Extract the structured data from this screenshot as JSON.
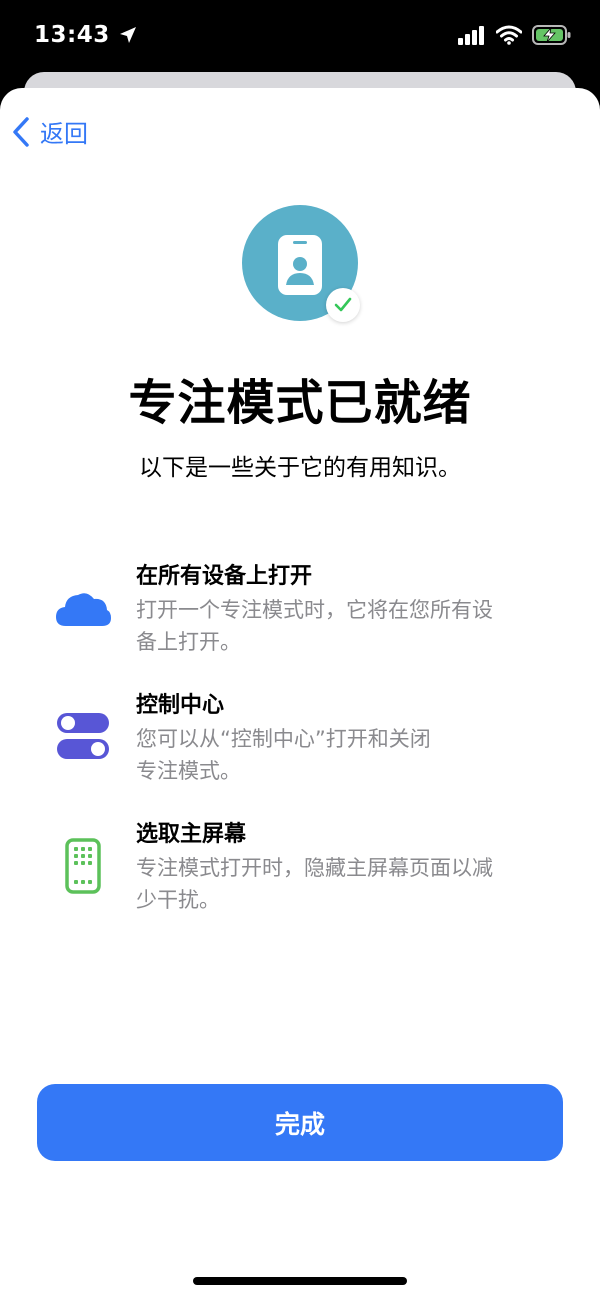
{
  "status_bar": {
    "time": "13:43"
  },
  "nav": {
    "back_label": "返回"
  },
  "header": {
    "title": "专注模式已就绪",
    "subtitle": "以下是一些关于它的有用知识。"
  },
  "features": [
    {
      "icon": "cloud-icon",
      "title": "在所有设备上打开",
      "desc_line1": "打开一个专注模式时，它将在您所有设",
      "desc_line2": "备上打开。"
    },
    {
      "icon": "toggle-switches-icon",
      "title": "控制中心",
      "desc_line1": "您可以从“控制中心”打开和关闭",
      "desc_line2": "专注模式。"
    },
    {
      "icon": "home-screen-icon",
      "title": "选取主屏幕",
      "desc_line1": "专注模式打开时，隐藏主屏幕页面以减",
      "desc_line2": "少干扰。"
    }
  ],
  "actions": {
    "done_label": "完成"
  },
  "colors": {
    "accent": "#3478f6",
    "hero": "#5ab0c9",
    "toggle": "#5856d6",
    "home_screen": "#5cc15a",
    "check": "#34c759",
    "battery": "#65c466"
  }
}
